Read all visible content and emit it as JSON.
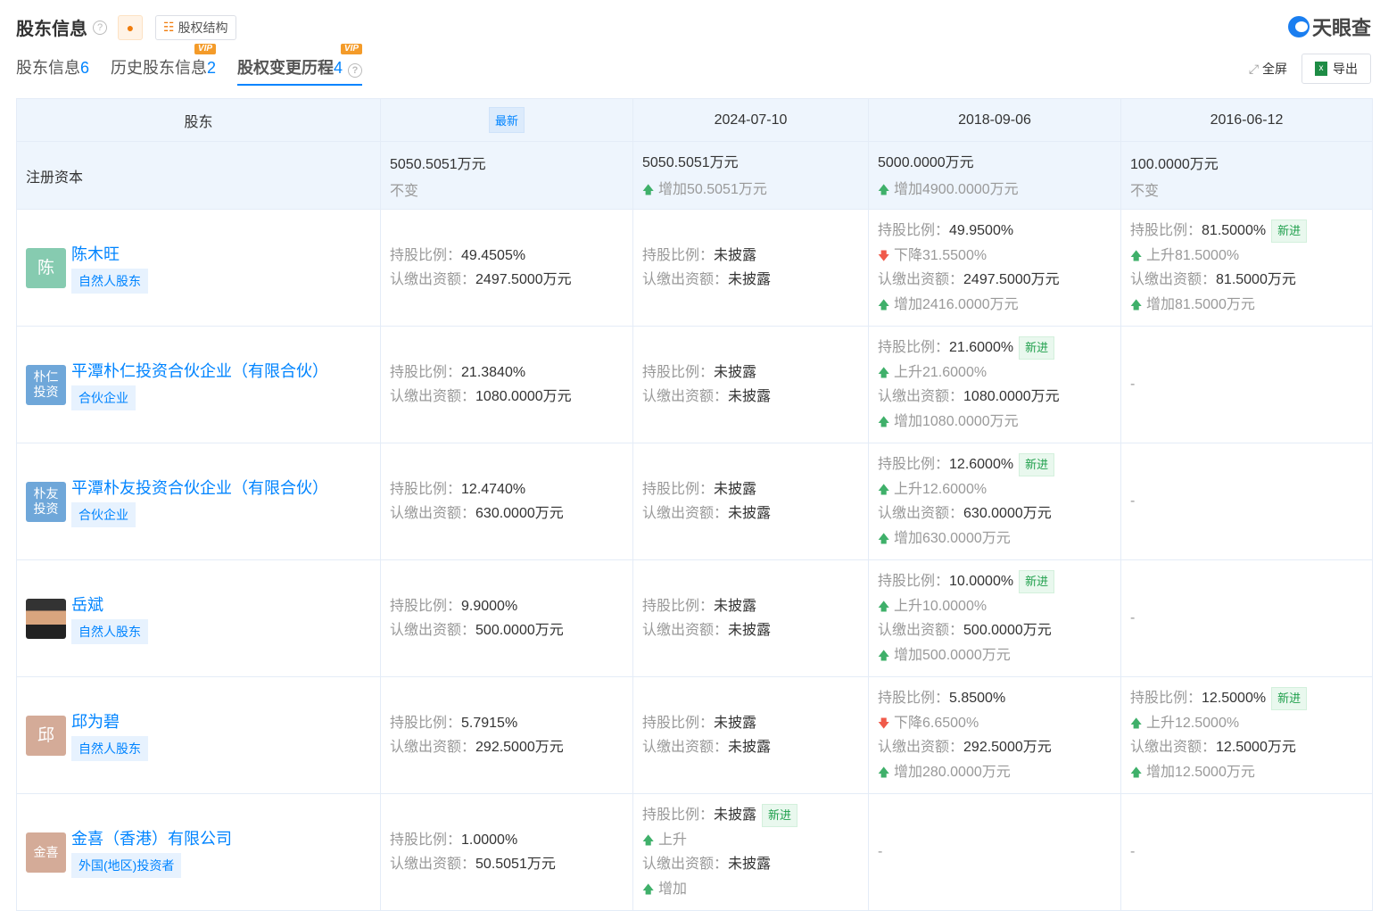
{
  "header": {
    "title": "股东信息",
    "struct_label": "股权结构",
    "brand": "天眼查"
  },
  "tabs": [
    {
      "label": "股东信息",
      "count": "6",
      "vip": ""
    },
    {
      "label": "历史股东信息",
      "count": "2",
      "vip": "VIP"
    },
    {
      "label": "股权变更历程",
      "count": "4",
      "vip": "VIP",
      "active": true
    }
  ],
  "tools": {
    "fullscreen": "全屏",
    "export": "导出"
  },
  "table": {
    "col0": "股东",
    "latest": "最新",
    "dates": [
      "2024-07-10",
      "2018-09-06",
      "2016-06-12"
    ],
    "capital": {
      "label": "注册资本",
      "cells": [
        {
          "value": "5050.5051万元",
          "sub": "不变",
          "dir": ""
        },
        {
          "value": "5050.5051万元",
          "sub": "增加50.5051万元",
          "dir": "up"
        },
        {
          "value": "5000.0000万元",
          "sub": "增加4900.0000万元",
          "dir": "up"
        },
        {
          "value": "100.0000万元",
          "sub": "不变",
          "dir": ""
        }
      ]
    },
    "labels": {
      "ratio": "持股比例：",
      "amount": "认缴出资额："
    },
    "rows": [
      {
        "name": "陈木旺",
        "tag": "自然人股东",
        "avatar": "陈",
        "color": "#86cbb0",
        "cells": [
          [
            {
              "k": "ratio",
              "v": "49.4505%"
            },
            {
              "k": "amount",
              "v": "2497.5000万元"
            }
          ],
          [
            {
              "k": "ratio",
              "v": "未披露"
            },
            {
              "k": "amount",
              "v": "未披露"
            }
          ],
          [
            {
              "k": "ratio",
              "v": "49.9500%"
            },
            {
              "c": "down",
              "v": "下降31.5500%"
            },
            {
              "k": "amount",
              "v": "2497.5000万元"
            },
            {
              "c": "up",
              "v": "增加2416.0000万元"
            }
          ],
          [
            {
              "k": "ratio",
              "v": "81.5000%",
              "b": "新进"
            },
            {
              "c": "up",
              "v": "上升81.5000%"
            },
            {
              "k": "amount",
              "v": "81.5000万元"
            },
            {
              "c": "up",
              "v": "增加81.5000万元"
            }
          ]
        ]
      },
      {
        "name": "平潭朴仁投资合伙企业（有限合伙）",
        "tag": "合伙企业",
        "avatar": "朴仁投资",
        "color": "#6fa7d9",
        "cells": [
          [
            {
              "k": "ratio",
              "v": "21.3840%"
            },
            {
              "k": "amount",
              "v": "1080.0000万元"
            }
          ],
          [
            {
              "k": "ratio",
              "v": "未披露"
            },
            {
              "k": "amount",
              "v": "未披露"
            }
          ],
          [
            {
              "k": "ratio",
              "v": "21.6000%",
              "b": "新进"
            },
            {
              "c": "up",
              "v": "上升21.6000%"
            },
            {
              "k": "amount",
              "v": "1080.0000万元"
            },
            {
              "c": "up",
              "v": "增加1080.0000万元"
            }
          ],
          "-"
        ]
      },
      {
        "name": "平潭朴友投资合伙企业（有限合伙）",
        "tag": "合伙企业",
        "avatar": "朴友投资",
        "color": "#6fa7d9",
        "cells": [
          [
            {
              "k": "ratio",
              "v": "12.4740%"
            },
            {
              "k": "amount",
              "v": "630.0000万元"
            }
          ],
          [
            {
              "k": "ratio",
              "v": "未披露"
            },
            {
              "k": "amount",
              "v": "未披露"
            }
          ],
          [
            {
              "k": "ratio",
              "v": "12.6000%",
              "b": "新进"
            },
            {
              "c": "up",
              "v": "上升12.6000%"
            },
            {
              "k": "amount",
              "v": "630.0000万元"
            },
            {
              "c": "up",
              "v": "增加630.0000万元"
            }
          ],
          "-"
        ]
      },
      {
        "name": "岳斌",
        "tag": "自然人股东",
        "avatar": "",
        "color": "photo",
        "cells": [
          [
            {
              "k": "ratio",
              "v": "9.9000%"
            },
            {
              "k": "amount",
              "v": "500.0000万元"
            }
          ],
          [
            {
              "k": "ratio",
              "v": "未披露"
            },
            {
              "k": "amount",
              "v": "未披露"
            }
          ],
          [
            {
              "k": "ratio",
              "v": "10.0000%",
              "b": "新进"
            },
            {
              "c": "up",
              "v": "上升10.0000%"
            },
            {
              "k": "amount",
              "v": "500.0000万元"
            },
            {
              "c": "up",
              "v": "增加500.0000万元"
            }
          ],
          "-"
        ]
      },
      {
        "name": "邱为碧",
        "tag": "自然人股东",
        "avatar": "邱",
        "color": "#d4ab98",
        "cells": [
          [
            {
              "k": "ratio",
              "v": "5.7915%"
            },
            {
              "k": "amount",
              "v": "292.5000万元"
            }
          ],
          [
            {
              "k": "ratio",
              "v": "未披露"
            },
            {
              "k": "amount",
              "v": "未披露"
            }
          ],
          [
            {
              "k": "ratio",
              "v": "5.8500%"
            },
            {
              "c": "down",
              "v": "下降6.6500%"
            },
            {
              "k": "amount",
              "v": "292.5000万元"
            },
            {
              "c": "up",
              "v": "增加280.0000万元"
            }
          ],
          [
            {
              "k": "ratio",
              "v": "12.5000%",
              "b": "新进"
            },
            {
              "c": "up",
              "v": "上升12.5000%"
            },
            {
              "k": "amount",
              "v": "12.5000万元"
            },
            {
              "c": "up",
              "v": "增加12.5000万元"
            }
          ]
        ]
      },
      {
        "name": "金喜（香港）有限公司",
        "tag": "外国(地区)投资者",
        "avatar": "金喜",
        "color": "#d4ab98",
        "cells": [
          [
            {
              "k": "ratio",
              "v": "1.0000%"
            },
            {
              "k": "amount",
              "v": "50.5051万元"
            }
          ],
          [
            {
              "k": "ratio",
              "v": "未披露",
              "b": "新进"
            },
            {
              "c": "up",
              "v": "上升"
            },
            {
              "k": "amount",
              "v": "未披露"
            },
            {
              "c": "up",
              "v": "增加"
            }
          ],
          "-",
          "-"
        ]
      }
    ]
  }
}
